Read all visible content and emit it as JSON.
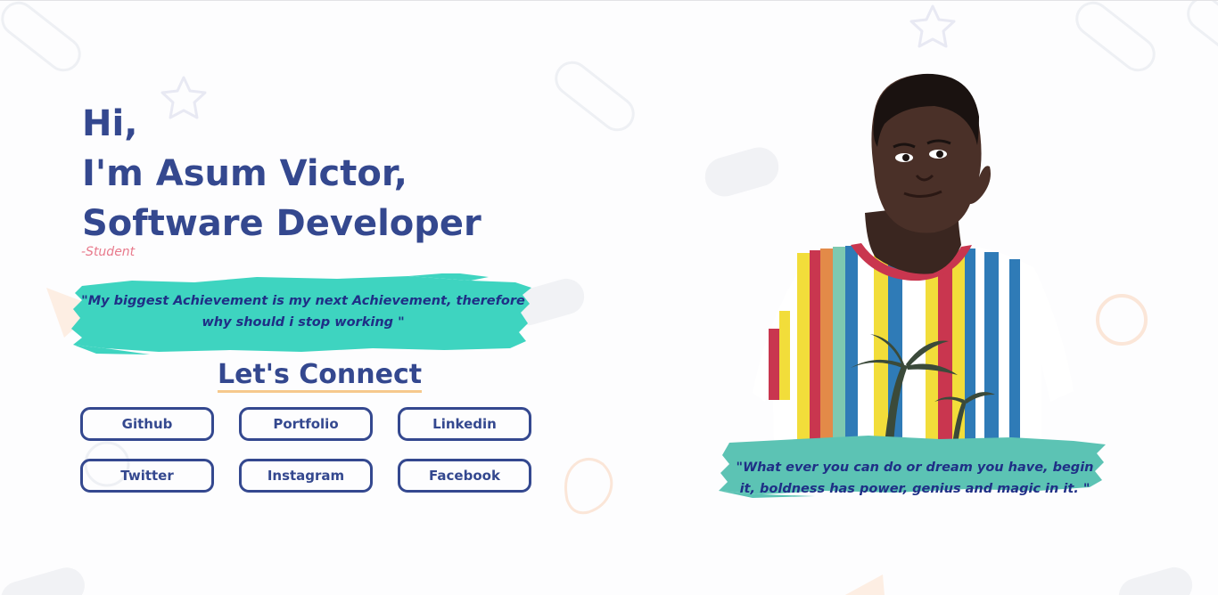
{
  "hero": {
    "greeting": "Hi,",
    "name_line": "I'm Asum Victor,",
    "role": "Software Developer",
    "subtitle": "-Student"
  },
  "quote_left": {
    "text": "\"My biggest Achievement is my next Achievement, therefore why should i stop working \""
  },
  "connect": {
    "title": "Let's Connect",
    "buttons": [
      {
        "label": "Github"
      },
      {
        "label": "Portfolio"
      },
      {
        "label": "Linkedin"
      },
      {
        "label": "Twitter"
      },
      {
        "label": "Instagram"
      },
      {
        "label": "Facebook"
      }
    ]
  },
  "quote_right": {
    "text": "\"What ever you can do or dream you have, begin it, boldness has power, genius and magic in it. \""
  },
  "colors": {
    "primary": "#34488f",
    "quote_text": "#1f2f86",
    "brush_left": "#3ed4c0",
    "brush_right": "#5cc3b4",
    "subtitle": "#e87a8c",
    "underline": "#f6c98d"
  }
}
